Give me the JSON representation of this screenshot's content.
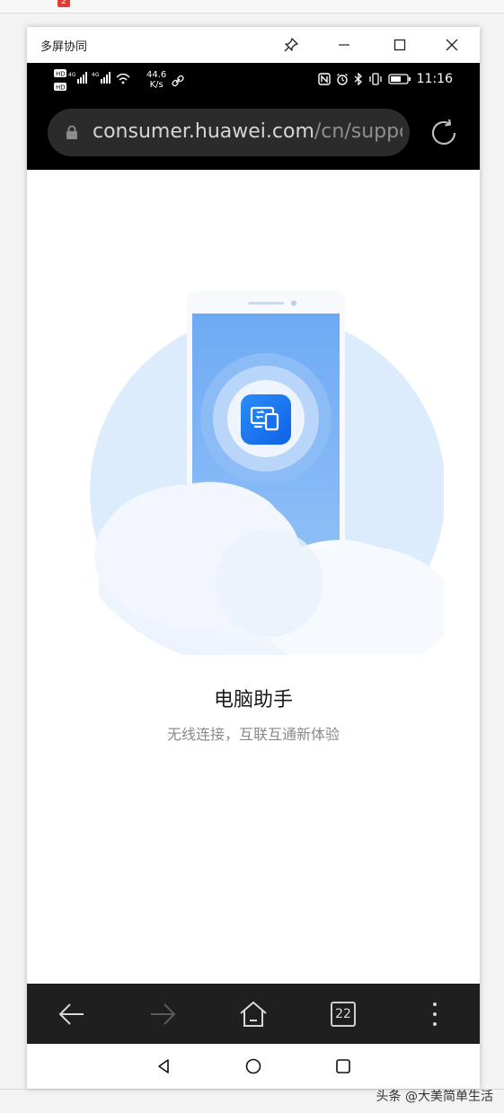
{
  "desktop": {
    "badge": "2",
    "watermark": "头条 @大美简单生活"
  },
  "window": {
    "title": "多屏协同"
  },
  "status_bar": {
    "net_left_top": "HD",
    "signal": "4G",
    "speed_value": "44.6",
    "speed_unit": "K/s",
    "time": "11:16"
  },
  "address_bar": {
    "domain": "consumer.huawei.com",
    "path": "/cn/support"
  },
  "page": {
    "title": "电脑助手",
    "subtitle": "无线连接，互联互通新体验"
  },
  "browser_nav": {
    "tab_count": "22"
  },
  "colors": {
    "circle_bg": "#dcebfb",
    "phone_screen": "#6aa9f6",
    "app_icon": "#1677f0",
    "navbar": "#1f1f1f"
  }
}
